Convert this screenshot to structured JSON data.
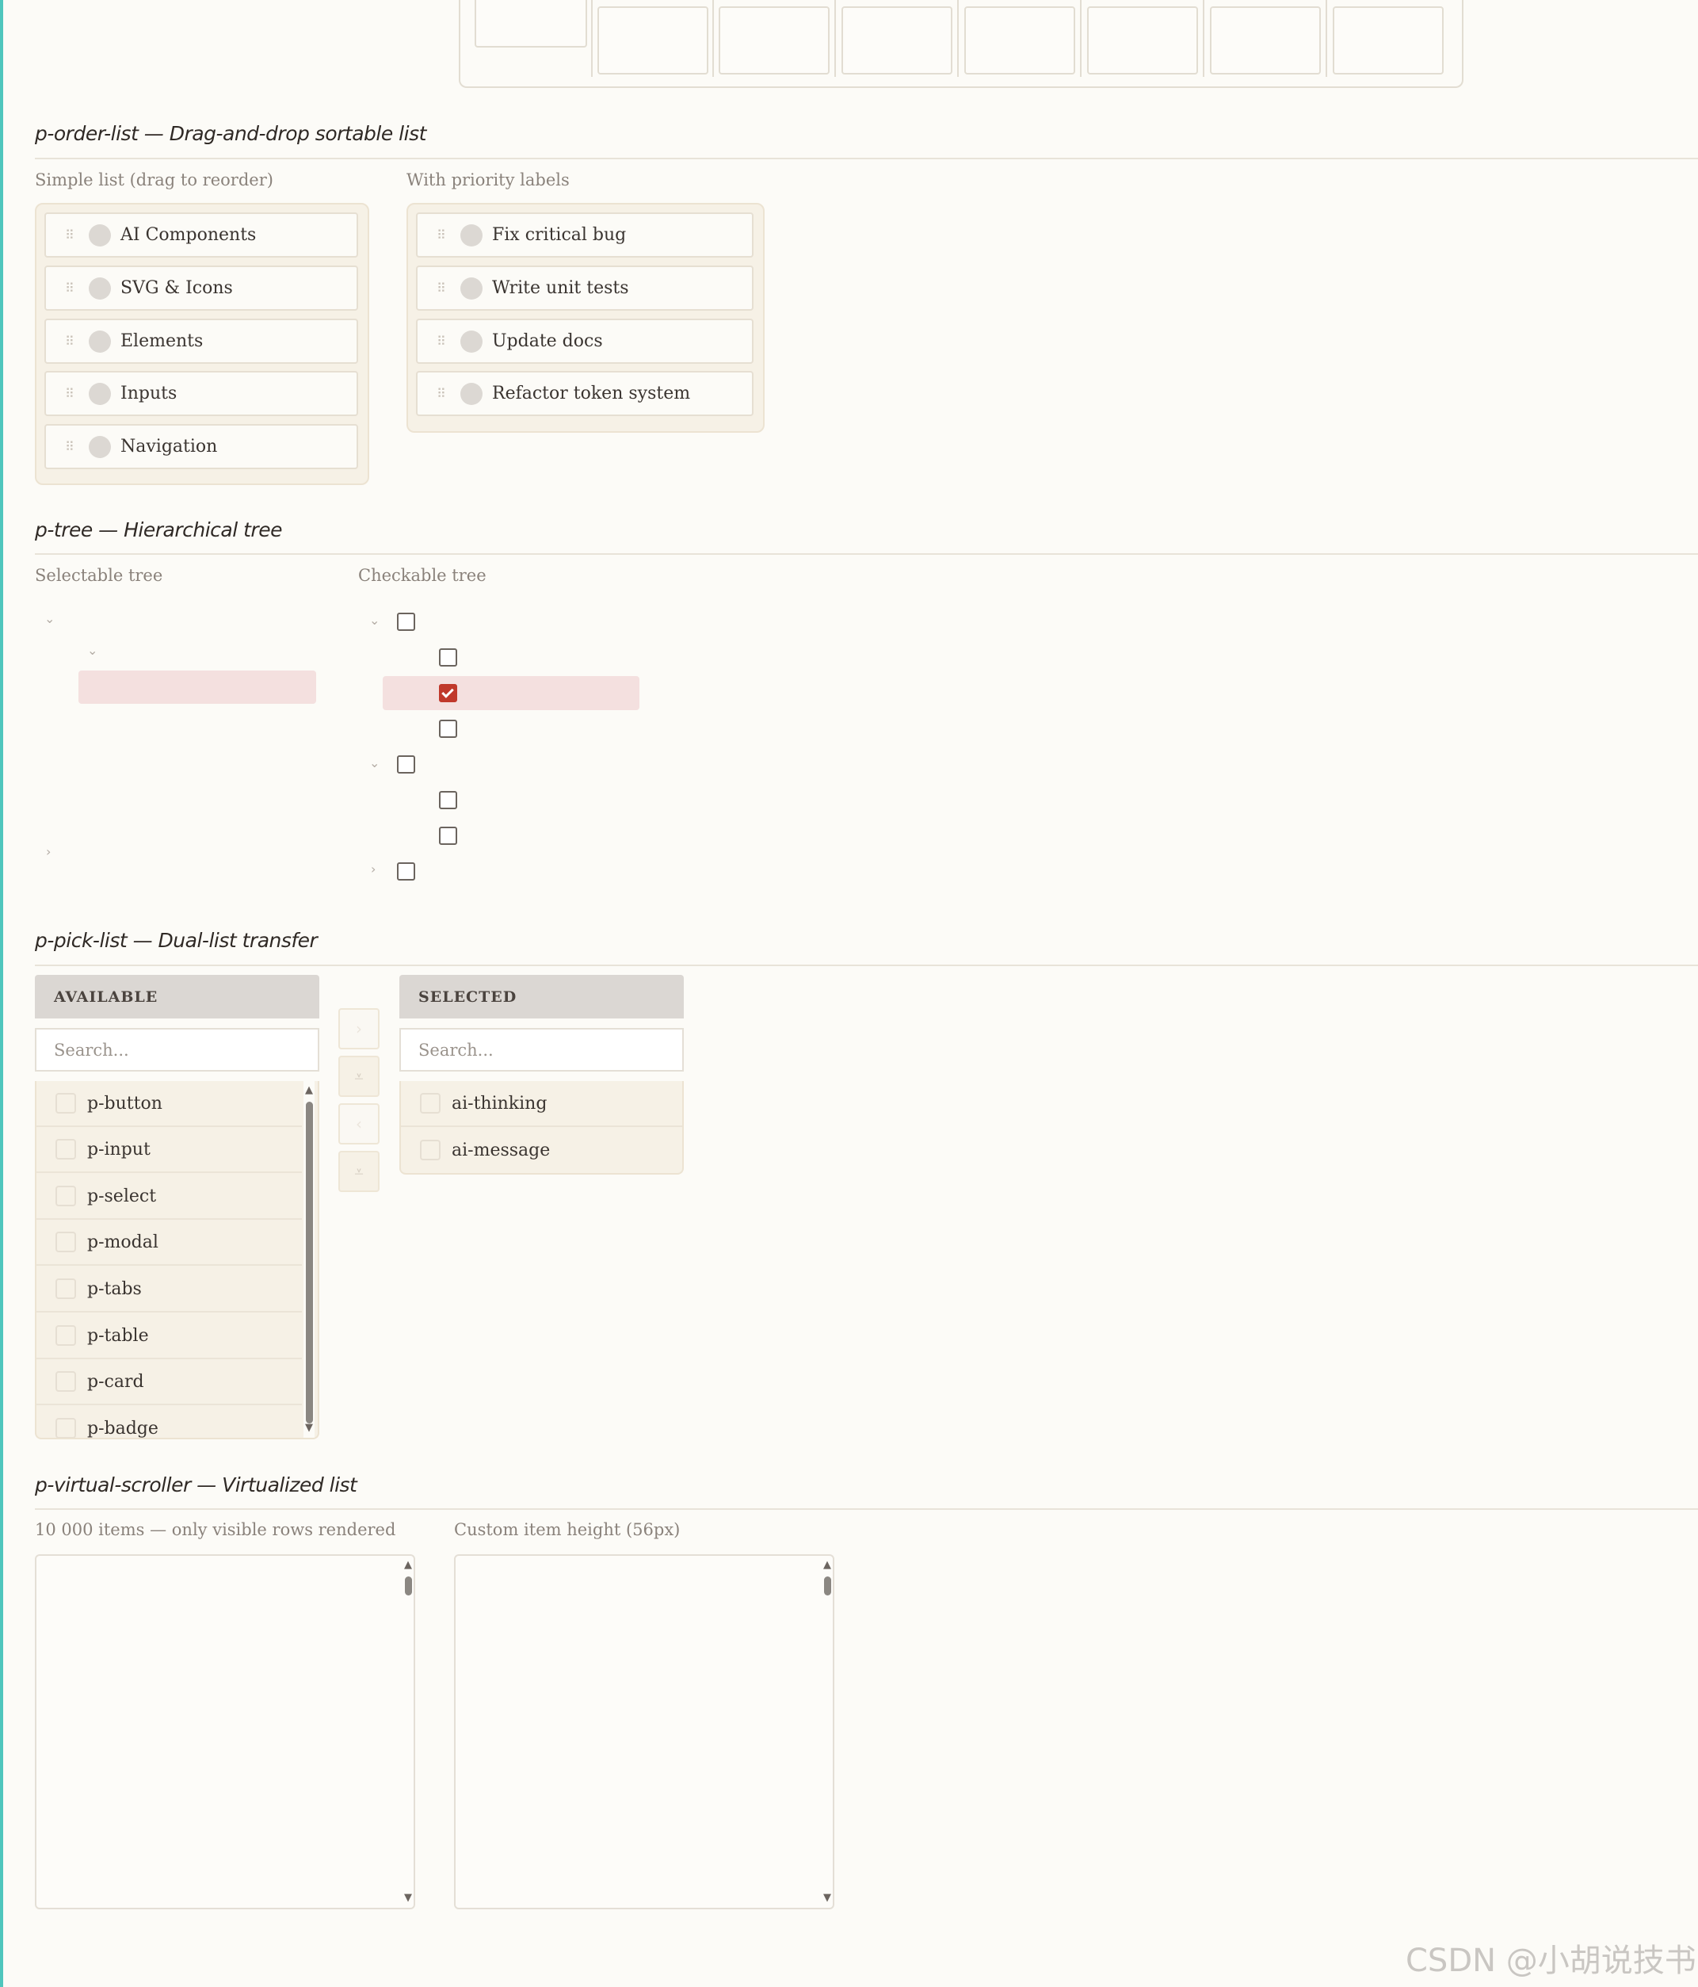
{
  "order_list": {
    "title": "p-order-list — Drag-and-drop sortable list",
    "simple": {
      "label": "Simple list (drag to reorder)",
      "items": [
        "AI Components",
        "SVG & Icons",
        "Elements",
        "Inputs",
        "Navigation"
      ]
    },
    "priority": {
      "label": "With priority labels",
      "items": [
        "Fix critical bug",
        "Write unit tests",
        "Update docs",
        "Refactor token system"
      ]
    }
  },
  "tree": {
    "title": "p-tree — Hierarchical tree",
    "selectable_label": "Selectable tree",
    "checkable_label": "Checkable tree",
    "checked_node_index": 2
  },
  "pick_list": {
    "title": "p-pick-list — Dual-list transfer",
    "available": {
      "header": "AVAILABLE",
      "search_placeholder": "Search...",
      "items": [
        "p-button",
        "p-input",
        "p-select",
        "p-modal",
        "p-tabs",
        "p-table",
        "p-card",
        "p-badge"
      ]
    },
    "selected": {
      "header": "SELECTED",
      "search_placeholder": "Search...",
      "items": [
        "ai-thinking",
        "ai-message"
      ]
    },
    "buttons": {
      "move_one_right": "›",
      "move_all_right": "⩡",
      "move_one_left": "‹",
      "move_all_left": "⩡"
    }
  },
  "virtual_scroller": {
    "title": "p-virtual-scroller — Virtualized list",
    "left_label": "10 000 items — only visible rows rendered",
    "right_label": "Custom item height (56px)"
  },
  "icons": {
    "grip": "drag-handle-icon",
    "expand": "chevron-down-icon",
    "collapse": "chevron-right-icon"
  },
  "colors": {
    "accent_bar": "#4fc6bd",
    "check": "#c0392b",
    "selection": "#f4e0df"
  },
  "watermark": "CSDN @小胡说技书"
}
